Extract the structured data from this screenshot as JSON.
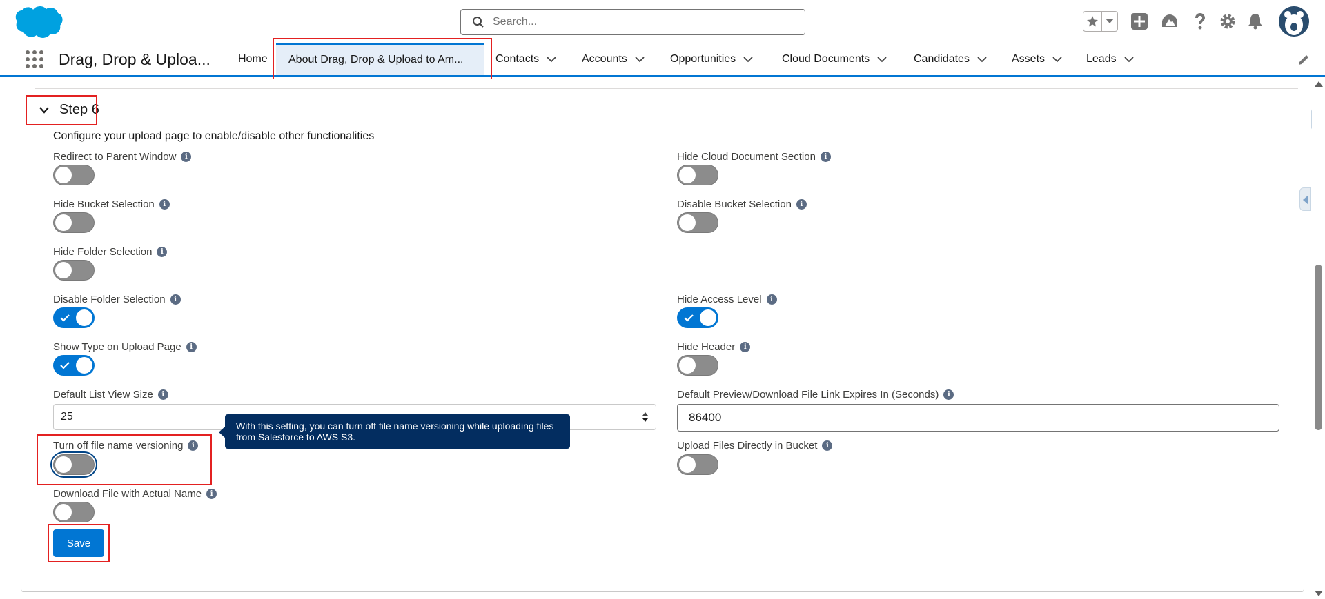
{
  "header": {
    "search_placeholder": "Search..."
  },
  "nav": {
    "app_name": "Drag, Drop & Uploa...",
    "items": [
      {
        "label": "Home",
        "has_menu": false
      },
      {
        "label": "About Drag, Drop & Upload to Am...",
        "has_menu": false,
        "active": true
      },
      {
        "label": "Contacts",
        "has_menu": true
      },
      {
        "label": "Accounts",
        "has_menu": true
      },
      {
        "label": "Opportunities",
        "has_menu": true
      },
      {
        "label": "Cloud Documents",
        "has_menu": true
      },
      {
        "label": "Candidates",
        "has_menu": true
      },
      {
        "label": "Assets",
        "has_menu": true
      },
      {
        "label": "Leads",
        "has_menu": true
      }
    ]
  },
  "step": {
    "title": "Step 6",
    "intro": "Configure your upload page to enable/disable other functionalities"
  },
  "fields": {
    "redirect_parent": {
      "label": "Redirect to Parent Window",
      "on": false
    },
    "hide_cloud_doc": {
      "label": "Hide Cloud Document Section",
      "on": false
    },
    "hide_bucket": {
      "label": "Hide Bucket Selection",
      "on": false
    },
    "disable_bucket": {
      "label": "Disable Bucket Selection",
      "on": false
    },
    "hide_folder": {
      "label": "Hide Folder Selection",
      "on": false
    },
    "disable_folder": {
      "label": "Disable Folder Selection",
      "on": true
    },
    "hide_access": {
      "label": "Hide Access Level",
      "on": true
    },
    "show_type": {
      "label": "Show Type on Upload Page",
      "on": true
    },
    "hide_header": {
      "label": "Hide Header",
      "on": false
    },
    "list_view_size": {
      "label": "Default List View Size",
      "value": "25"
    },
    "link_expires": {
      "label": "Default Preview/Download File Link Expires In (Seconds)",
      "value": "86400"
    },
    "turn_off_versioning": {
      "label": "Turn off file name versioning",
      "on": false
    },
    "upload_direct": {
      "label": "Upload Files Directly in Bucket",
      "on": false
    },
    "download_actual": {
      "label": "Download File with Actual Name",
      "on": false
    }
  },
  "tooltip": {
    "text": "With this setting, you can turn off file name versioning while uploading files from Salesforce to AWS S3."
  },
  "actions": {
    "save_label": "Save"
  },
  "colors": {
    "brand": "#0176d3",
    "tooltip_bg": "#032d60",
    "highlight": "#e32121"
  }
}
